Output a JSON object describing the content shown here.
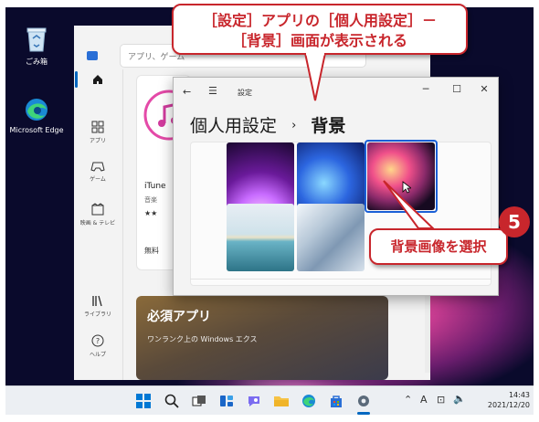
{
  "desktop": {
    "icons": [
      {
        "label": "ごみ箱",
        "icon": "recycle-bin-icon"
      },
      {
        "label": "Microsoft Edge",
        "icon": "edge-icon"
      }
    ]
  },
  "store": {
    "search_placeholder": "アプリ、ゲーム",
    "nav": [
      {
        "label": "",
        "icon": "home-icon",
        "active": true
      },
      {
        "label": "アプリ",
        "icon": "apps-icon"
      },
      {
        "label": "ゲーム",
        "icon": "gamepad-icon"
      },
      {
        "label": "映画 & テレビ",
        "icon": "film-icon"
      },
      {
        "label": "ライブラリ",
        "icon": "library-icon"
      },
      {
        "label": "ヘルプ",
        "icon": "help-icon"
      }
    ],
    "itunes": {
      "name": "iTune",
      "category": "音楽",
      "rating": "★★",
      "price": "無料"
    },
    "essential": {
      "title": "必須アプリ",
      "line1": "ワンランク上の Windows エクス"
    }
  },
  "settings": {
    "title": "設定",
    "breadcrumb_parent": "個人用設定",
    "breadcrumb_sep": "›",
    "breadcrumb_current": "背景",
    "selected_index": 2,
    "wallpapers": [
      {
        "name": "bloom-purple",
        "colors": [
          "#f2a8ff",
          "#a03fc0",
          "#2a0b44"
        ]
      },
      {
        "name": "bloom-blue",
        "colors": [
          "#88d0ff",
          "#2156d6",
          "#0e1a5c"
        ]
      },
      {
        "name": "flow-orange",
        "colors": [
          "#ffcf7a",
          "#e8507a",
          "#1a0d25"
        ]
      },
      {
        "name": "lake",
        "colors": [
          "#f2ead5",
          "#8fc9d8",
          "#3d7f91"
        ]
      },
      {
        "name": "ribbon-grey",
        "colors": [
          "#e8eff5",
          "#9cb1c6",
          "#4f6b86"
        ]
      }
    ]
  },
  "callouts": {
    "top_line1": "［設定］アプリの［個人用設定］－",
    "top_line2": "［背景］画面が表示される",
    "step_number": "5",
    "select_text": "背景画像を選択"
  },
  "taskbar": {
    "time": "14:43",
    "date": "2021/12/20",
    "ime": "A",
    "colors": {
      "accent": "#0067c0"
    }
  }
}
